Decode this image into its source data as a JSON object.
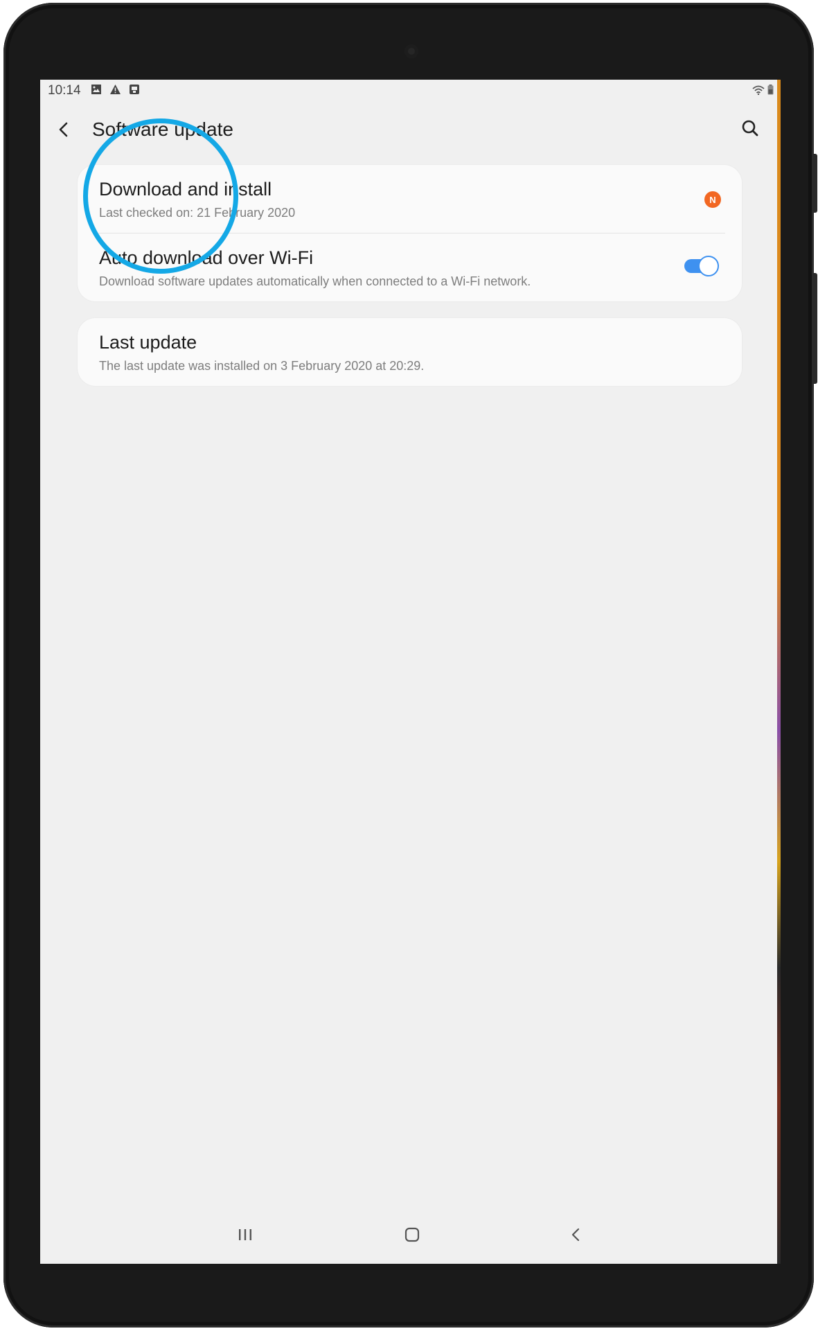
{
  "status_bar": {
    "time": "10:14",
    "left_icons": [
      "gallery-icon",
      "alert-icon",
      "screenshot-icon"
    ],
    "right_icons": [
      "wifi-icon",
      "battery-icon"
    ]
  },
  "app_bar": {
    "title": "Software update",
    "back_icon": "back-arrow-icon",
    "search_icon": "search-icon"
  },
  "settings": {
    "download": {
      "title": "Download and install",
      "subtitle": "Last checked on: 21 February 2020",
      "badge": "N",
      "badge_color": "#f26722"
    },
    "auto_download": {
      "title": "Auto download over Wi-Fi",
      "subtitle": "Download software updates automatically when connected to a Wi-Fi network.",
      "enabled": true,
      "toggle_color": "#3e91f0"
    },
    "last_update": {
      "title": "Last update",
      "subtitle": "The last update was installed on 3 February 2020 at 20:29."
    }
  },
  "annotation": {
    "highlight_color": "#14a8e6",
    "target": "Download and install"
  },
  "nav_bar": {
    "buttons": [
      "recents-icon",
      "home-icon",
      "back-icon"
    ]
  }
}
